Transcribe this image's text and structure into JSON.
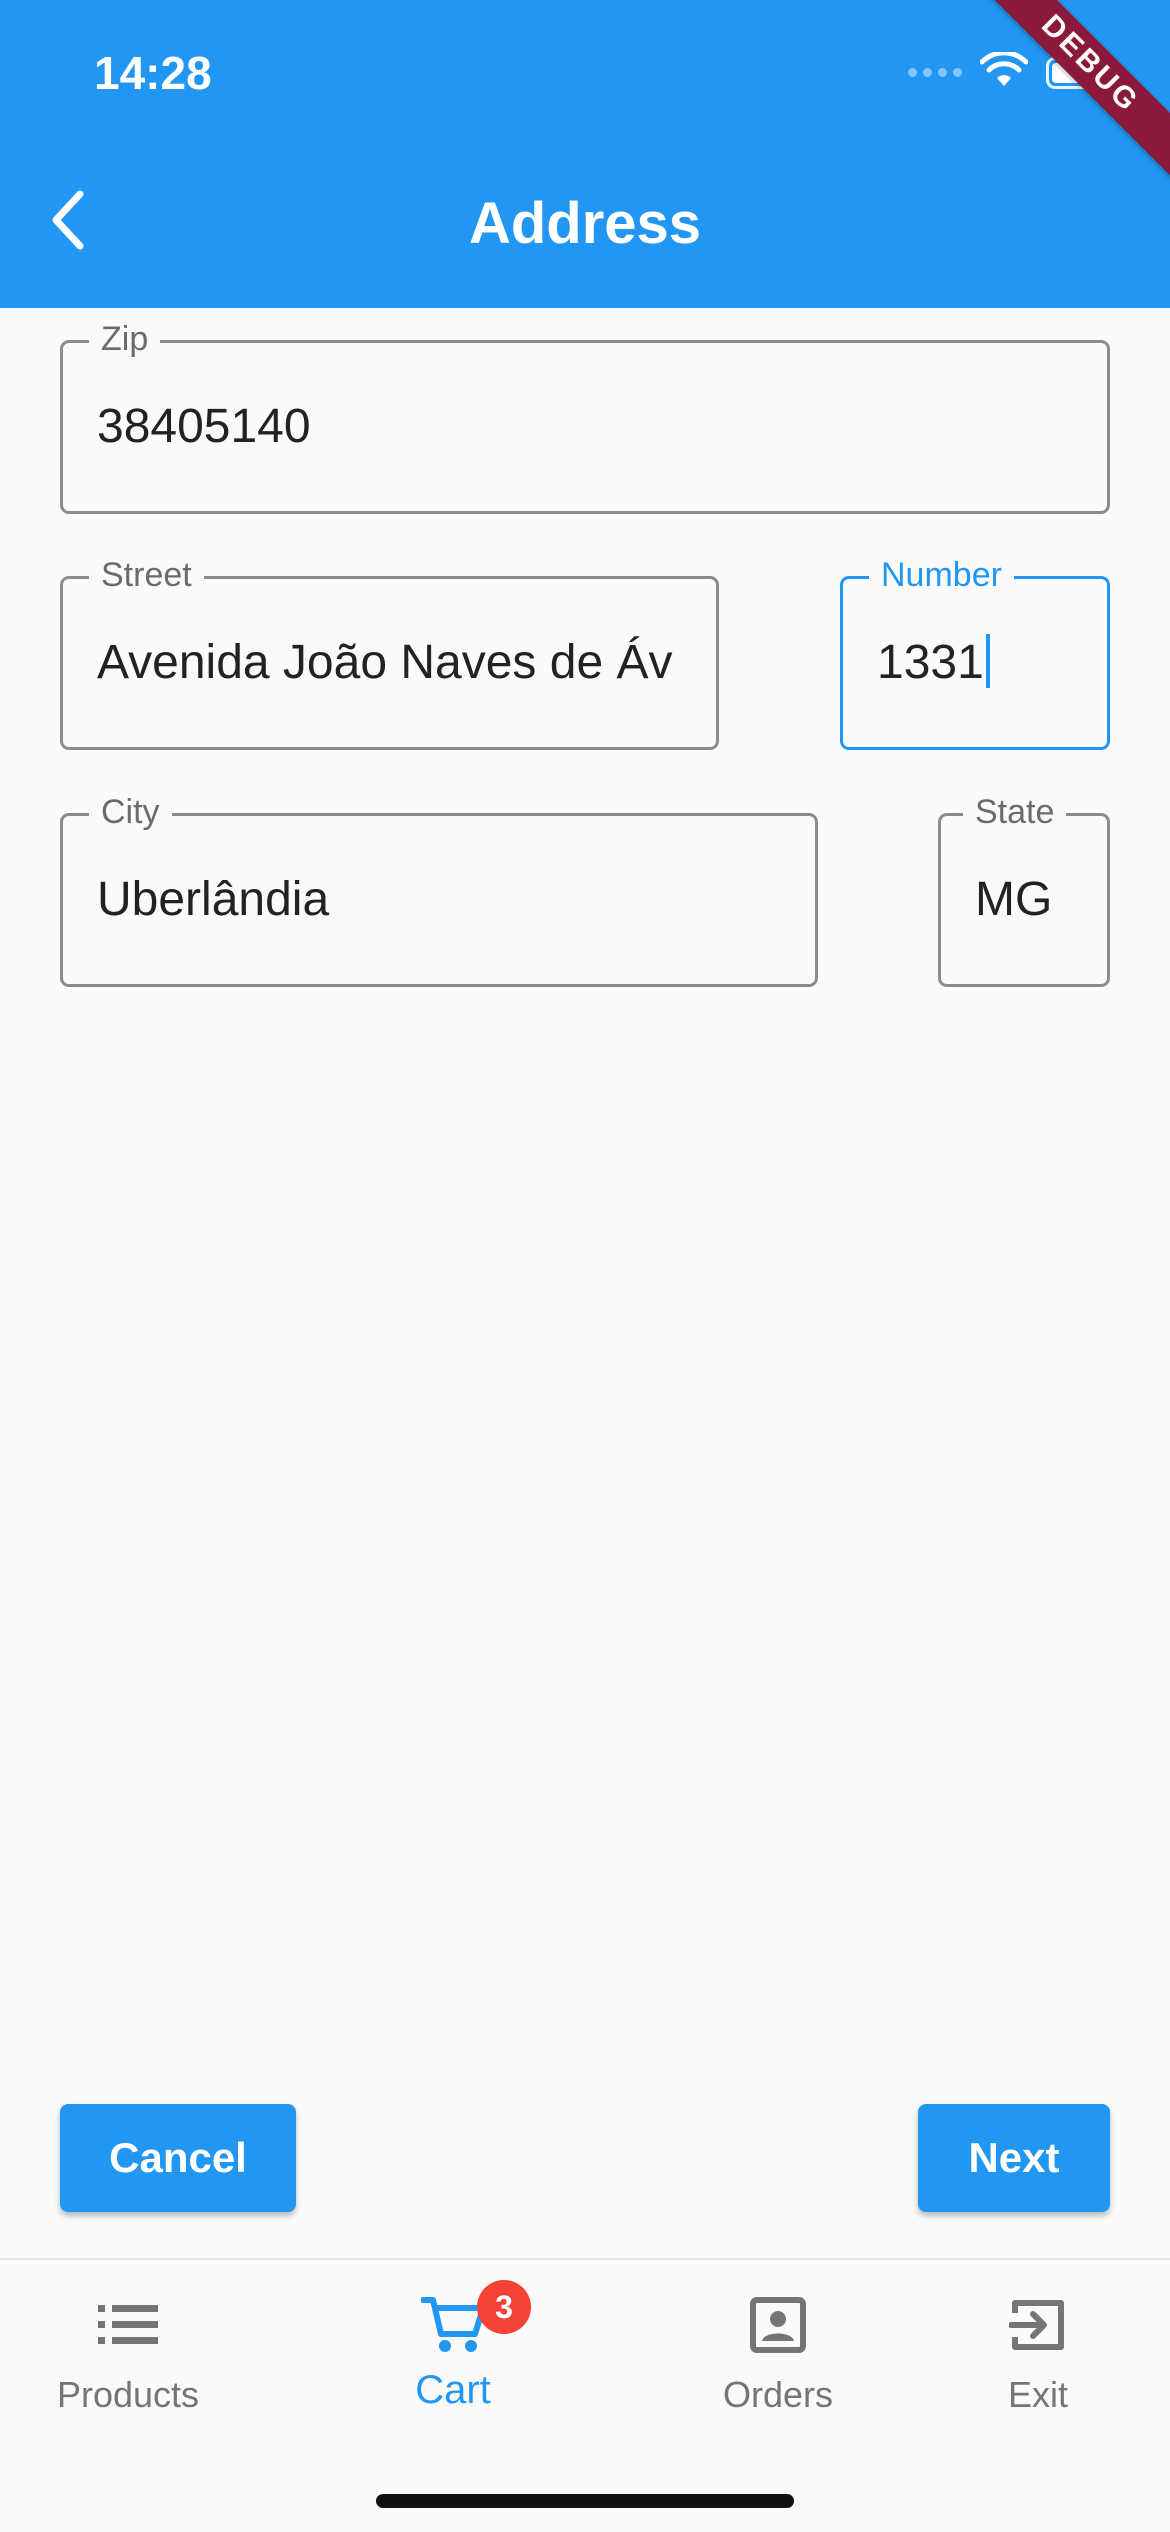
{
  "status_bar": {
    "time": "14:28"
  },
  "debug_banner": "DEBUG",
  "app_bar": {
    "title": "Address"
  },
  "form": {
    "zip": {
      "label": "Zip",
      "value": "38405140"
    },
    "street": {
      "label": "Street",
      "value": "Avenida João Naves de Áv"
    },
    "number": {
      "label": "Number",
      "value": "1331"
    },
    "city": {
      "label": "City",
      "value": "Uberlândia"
    },
    "state": {
      "label": "State",
      "value": "MG"
    }
  },
  "buttons": {
    "cancel": "Cancel",
    "next": "Next"
  },
  "bottom_nav": {
    "items": [
      {
        "label": "Products",
        "icon": "list-icon"
      },
      {
        "label": "Cart",
        "icon": "cart-icon",
        "badge": "3",
        "active": true
      },
      {
        "label": "Orders",
        "icon": "orders-icon"
      },
      {
        "label": "Exit",
        "icon": "exit-icon"
      }
    ]
  },
  "colors": {
    "primary": "#2196f3",
    "badge": "#f44336",
    "debug_banner": "#8b1a3a"
  }
}
